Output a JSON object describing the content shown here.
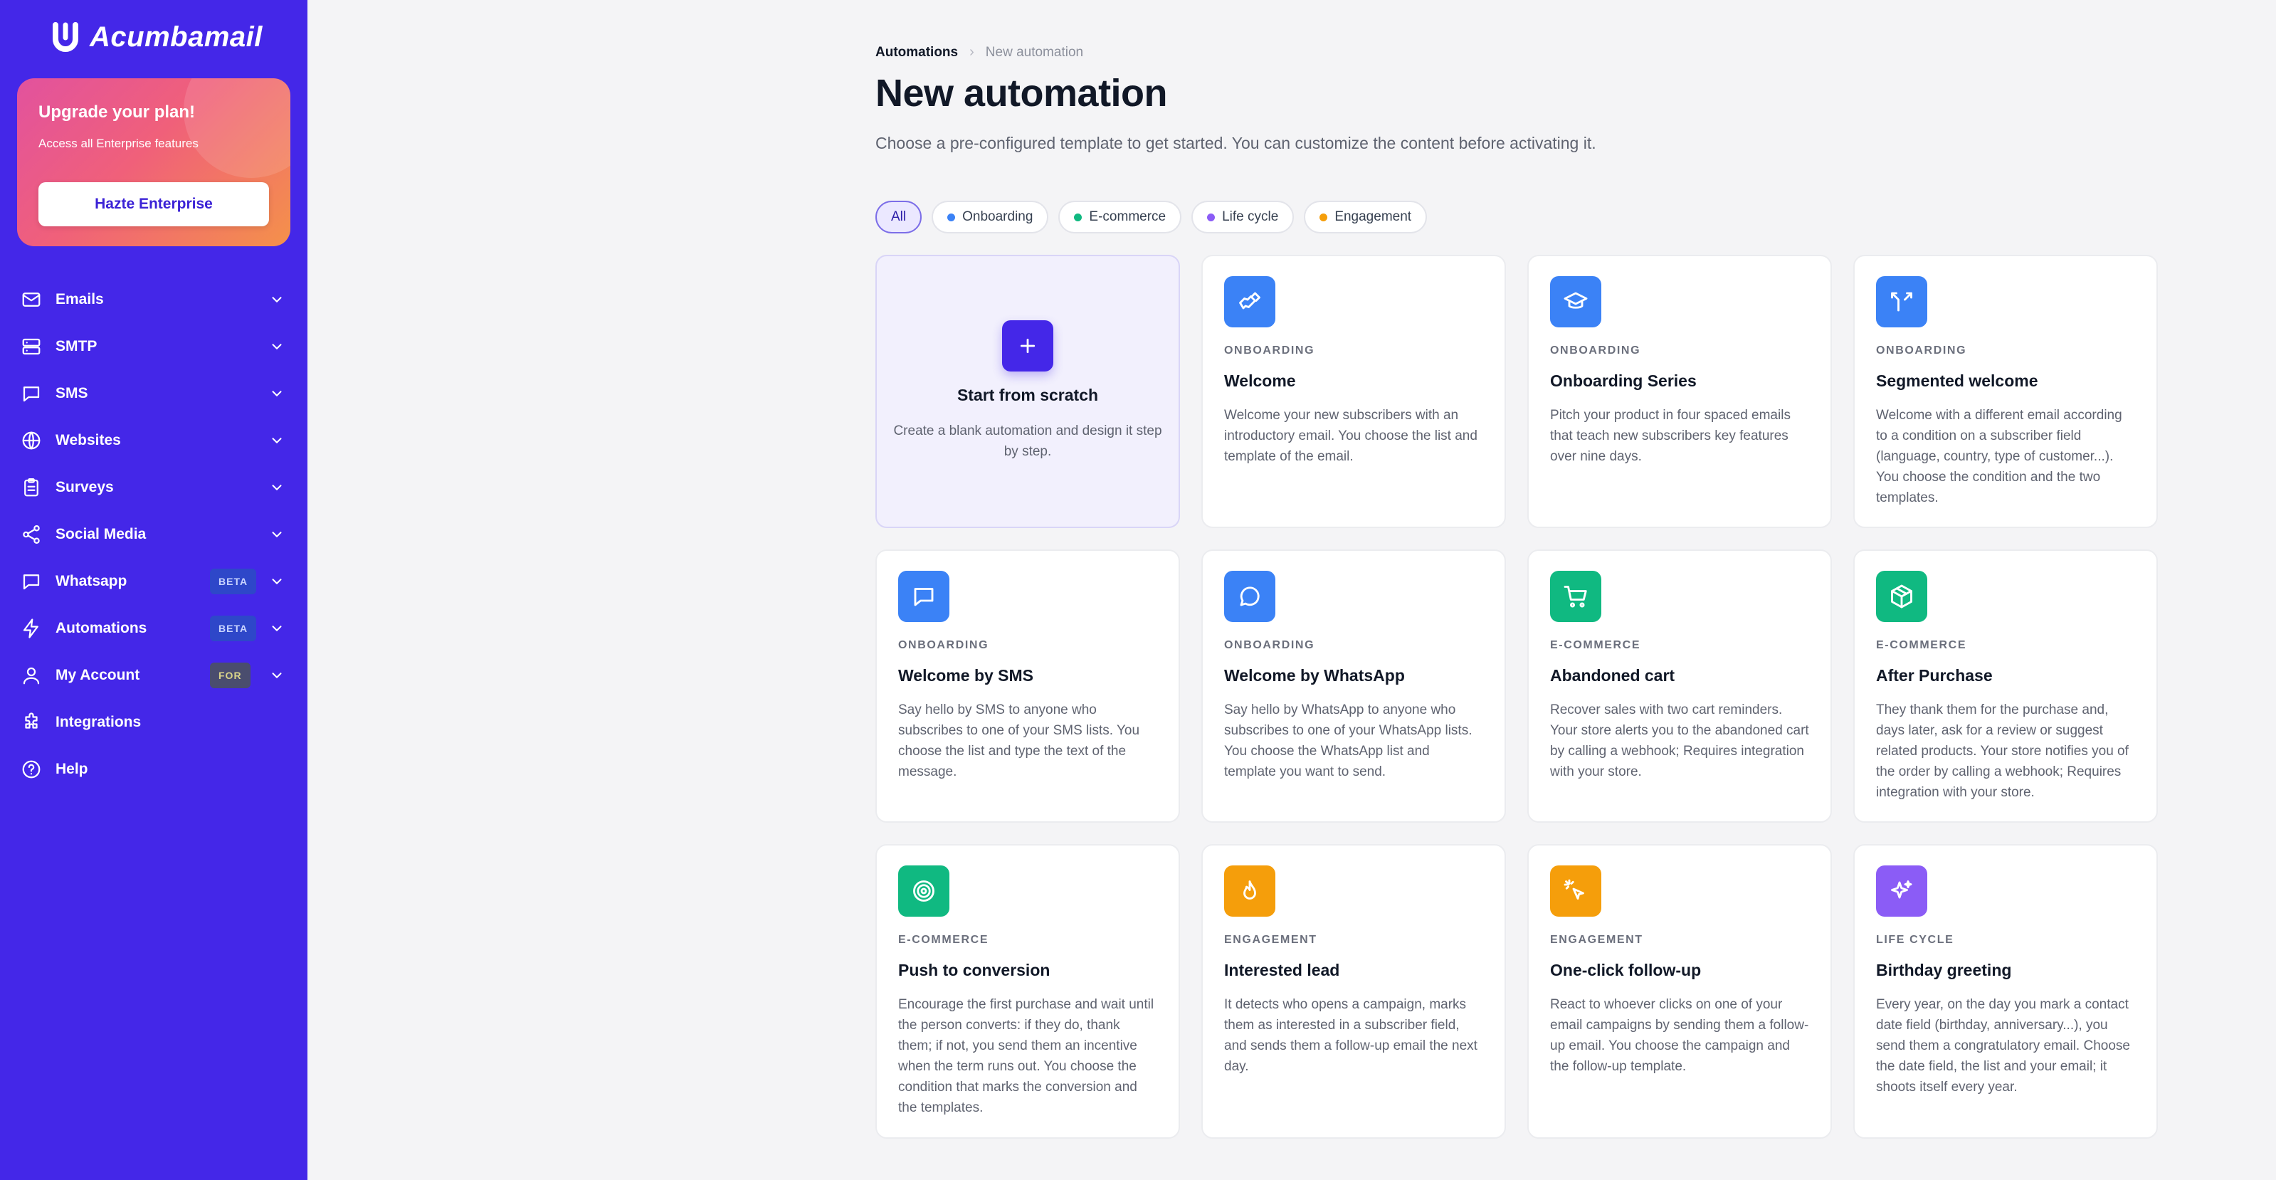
{
  "app": {
    "name": "Acumbamail"
  },
  "upgrade": {
    "title": "Upgrade your plan!",
    "subtitle": "Access all Enterprise features",
    "button": "Hazte Enterprise"
  },
  "sidebar": {
    "items": [
      {
        "label": "Emails",
        "icon": "mail-icon",
        "badge": "",
        "chevron": true
      },
      {
        "label": "SMTP",
        "icon": "server-icon",
        "badge": "",
        "chevron": true
      },
      {
        "label": "SMS",
        "icon": "message-square-icon",
        "badge": "",
        "chevron": true
      },
      {
        "label": "Websites",
        "icon": "globe-icon",
        "badge": "",
        "chevron": true
      },
      {
        "label": "Surveys",
        "icon": "clipboard-icon",
        "badge": "",
        "chevron": true
      },
      {
        "label": "Social Media",
        "icon": "share-icon",
        "badge": "",
        "chevron": true
      },
      {
        "label": "Whatsapp",
        "icon": "chat-icon",
        "badge": "BETA",
        "chevron": true
      },
      {
        "label": "Automations",
        "icon": "lightning-icon",
        "badge": "BETA",
        "chevron": true
      },
      {
        "label": "My Account",
        "icon": "user-icon",
        "badge": "FOR",
        "chevron": true
      },
      {
        "label": "Integrations",
        "icon": "puzzle-icon",
        "badge": "",
        "chevron": false
      },
      {
        "label": "Help",
        "icon": "help-circle-icon",
        "badge": "",
        "chevron": false
      }
    ]
  },
  "breadcrumb": {
    "root": "Automations",
    "separator": "›",
    "current": "New automation"
  },
  "page": {
    "title": "New automation",
    "subtitle": "Choose a pre-configured template to get started. You can customize the content before activating it."
  },
  "filters": [
    {
      "label": "All",
      "color": "",
      "active": true
    },
    {
      "label": "Onboarding",
      "color": "#3b82f6",
      "active": false
    },
    {
      "label": "E-commerce",
      "color": "#10b981",
      "active": false
    },
    {
      "label": "Life cycle",
      "color": "#8b5cf6",
      "active": false
    },
    {
      "label": "Engagement",
      "color": "#f59e0b",
      "active": false
    }
  ],
  "scratch": {
    "title": "Start from scratch",
    "description": "Create a blank automation and design it step by step."
  },
  "templates": [
    {
      "category": "ONBOARDING",
      "title": "Welcome",
      "icon": "handshake-icon",
      "color": "#3b82f6",
      "description": "Welcome your new subscribers with an introductory email. You choose the list and template of the email."
    },
    {
      "category": "ONBOARDING",
      "title": "Onboarding Series",
      "icon": "graduation-cap-icon",
      "color": "#3b82f6",
      "description": "Pitch your product in four spaced emails that teach new subscribers key features over nine days."
    },
    {
      "category": "ONBOARDING",
      "title": "Segmented welcome",
      "icon": "split-arrows-icon",
      "color": "#3b82f6",
      "description": "Welcome with a different email according to a condition on a subscriber field (language, country, type of customer...). You choose the condition and the two templates."
    },
    {
      "category": "ONBOARDING",
      "title": "Welcome by SMS",
      "icon": "sms-icon",
      "color": "#3b82f6",
      "description": "Say hello by SMS to anyone who subscribes to one of your SMS lists. You choose the list and type the text of the message."
    },
    {
      "category": "ONBOARDING",
      "title": "Welcome by WhatsApp",
      "icon": "whatsapp-icon",
      "color": "#3b82f6",
      "description": "Say hello by WhatsApp to anyone who subscribes to one of your WhatsApp lists. You choose the WhatsApp list and template you want to send."
    },
    {
      "category": "E-COMMERCE",
      "title": "Abandoned cart",
      "icon": "cart-icon",
      "color": "#10b981",
      "description": "Recover sales with two cart reminders. Your store alerts you to the abandoned cart by calling a webhook; Requires integration with your store."
    },
    {
      "category": "E-COMMERCE",
      "title": "After Purchase",
      "icon": "package-icon",
      "color": "#10b981",
      "description": "They thank them for the purchase and, days later, ask for a review or suggest related products. Your store notifies you of the order by calling a webhook; Requires integration with your store."
    },
    {
      "category": "E-COMMERCE",
      "title": "Push to conversion",
      "icon": "target-icon",
      "color": "#10b981",
      "description": "Encourage the first purchase and wait until the person converts: if they do, thank them; if not, you send them an incentive when the term runs out. You choose the condition that marks the conversion and the templates."
    },
    {
      "category": "ENGAGEMENT",
      "title": "Interested lead",
      "icon": "flame-icon",
      "color": "#f59e0b",
      "description": "It detects who opens a campaign, marks them as interested in a subscriber field, and sends them a follow-up email the next day."
    },
    {
      "category": "ENGAGEMENT",
      "title": "One-click follow-up",
      "icon": "click-pointer-icon",
      "color": "#f59e0b",
      "description": "React to whoever clicks on one of your email campaigns by sending them a follow-up email. You choose the campaign and the follow-up template."
    },
    {
      "category": "LIFE CYCLE",
      "title": "Birthday greeting",
      "icon": "sparkles-icon",
      "color": "#8b5cf6",
      "description": "Every year, on the day you mark a contact date field (birthday, anniversary...), you send them a congratulatory email. Choose the date field, the list and your email; it shoots itself every year."
    }
  ]
}
